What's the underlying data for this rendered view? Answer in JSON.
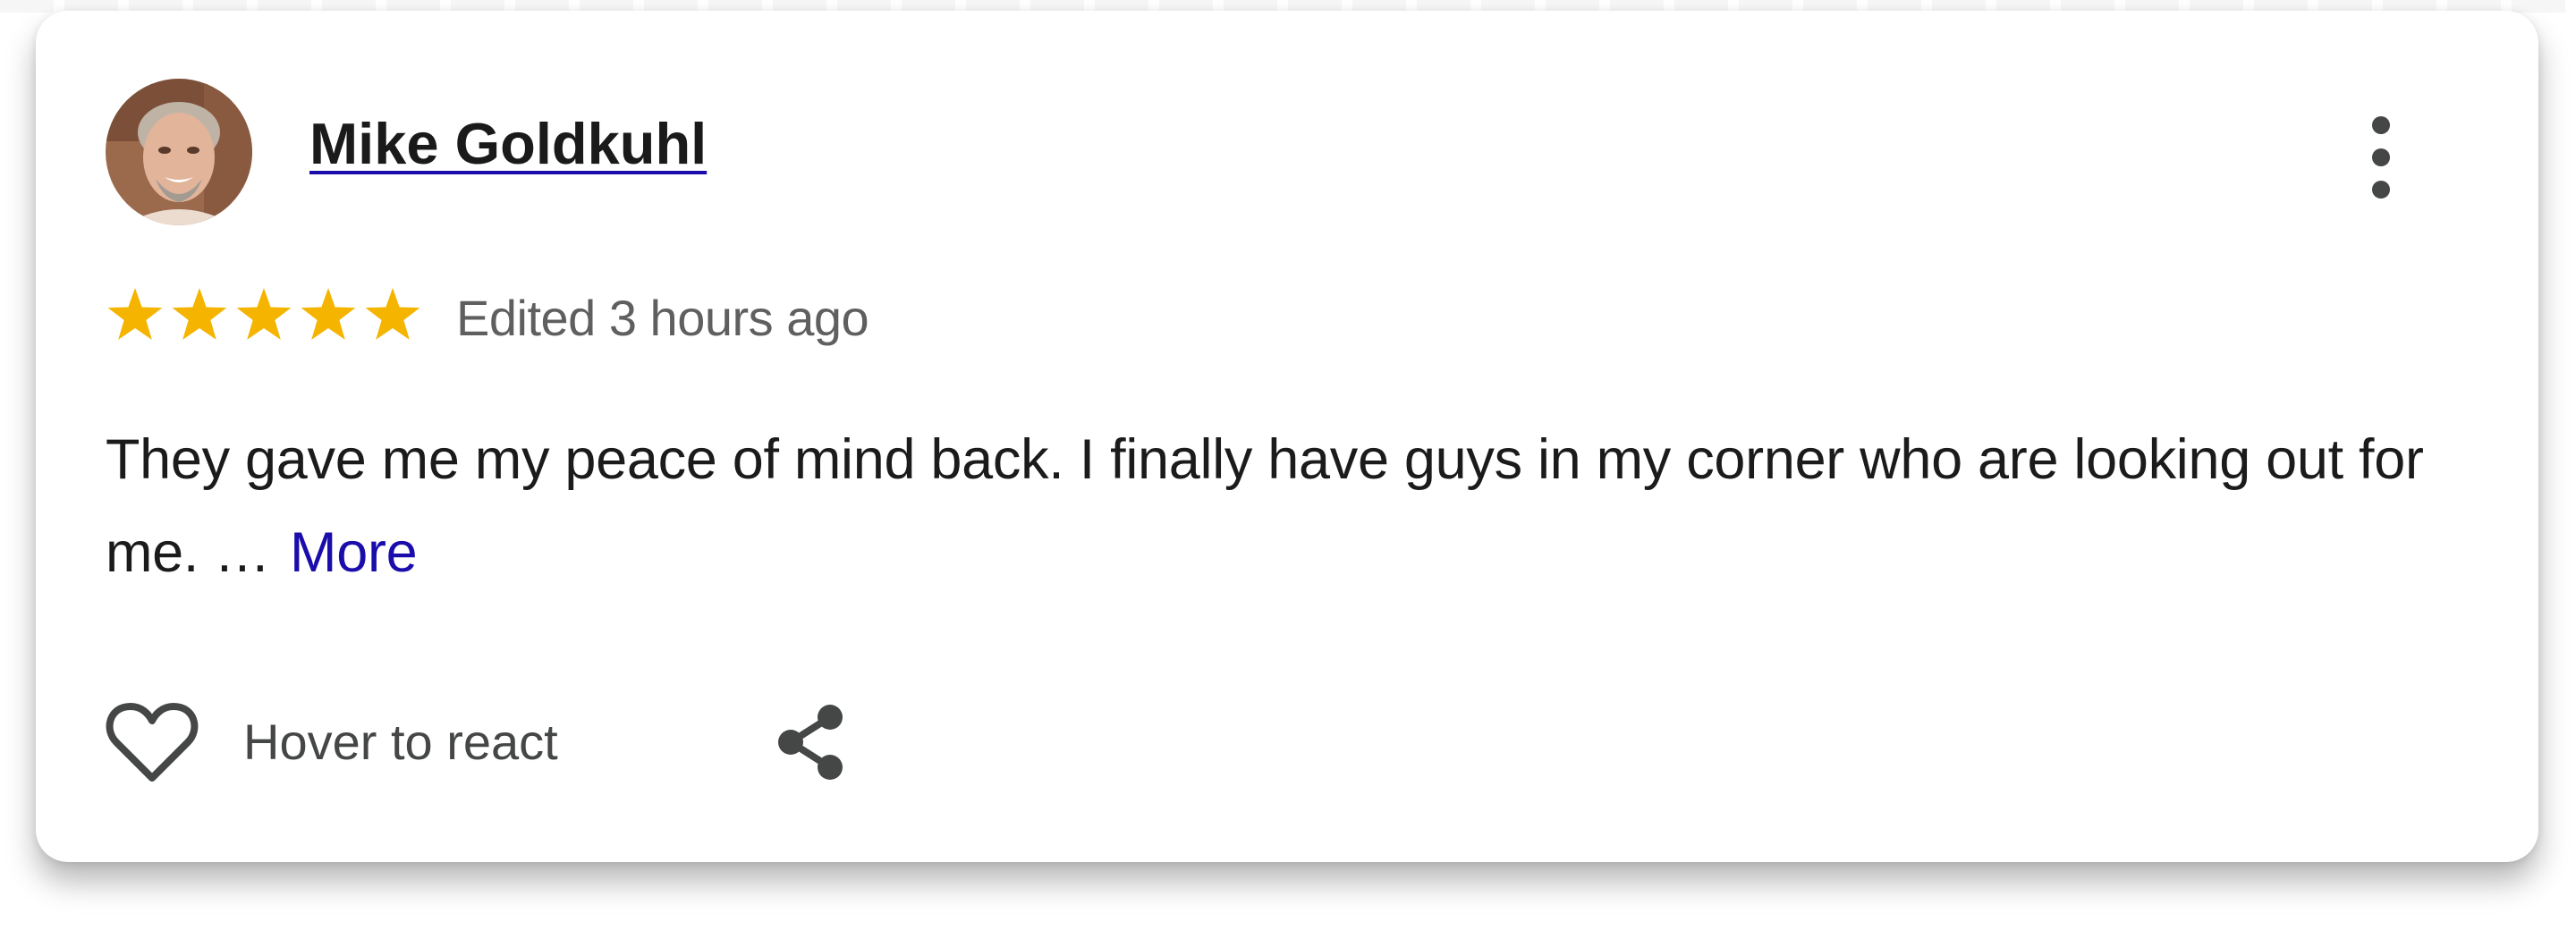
{
  "review": {
    "author_name": "Mike Goldkuhl",
    "rating": 5,
    "rating_max": 5,
    "timestamp": "Edited 3 hours ago",
    "text": "They gave me my peace of mind back. I finally have guys in my corner who are looking out for me. …",
    "more_label": "More"
  },
  "actions": {
    "react_label": "Hover to react",
    "react_icon": "heart-outline-icon",
    "share_icon": "share-icon",
    "menu_icon": "more-vert-icon"
  },
  "colors": {
    "star": "#F4B400",
    "link": "#1A0DAB",
    "text_primary": "#1B1B1B",
    "text_secondary": "#5F5F5F",
    "icon": "#444746"
  }
}
